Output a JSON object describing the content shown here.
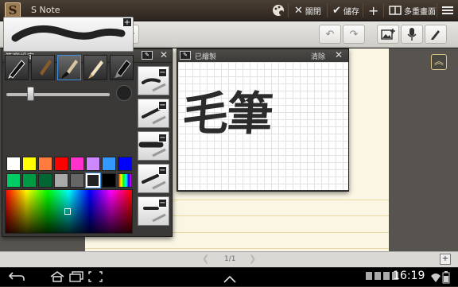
{
  "app": {
    "icon_letter": "S",
    "title": "S Note"
  },
  "actionbar": {
    "close_label": "關閉",
    "save_label": "儲存",
    "multiview_label": "多重畫面"
  },
  "pen_settings": {
    "title": "筆寫設定",
    "add_symbol": "+",
    "pen_types": [
      "fountain-pen",
      "brush",
      "calligraphy-brush",
      "pencil",
      "marker"
    ],
    "selected_pen_index": 2,
    "size_level": 0.2,
    "colors_row1": [
      "#ffffff",
      "#ffff00",
      "#ff7a3c",
      "#ff0000",
      "#ff33cc",
      "#cc88ff",
      "#3399ff",
      "#0000ff"
    ],
    "colors_row2": [
      "#00cc66",
      "#009944",
      "#006633",
      "#aaaaaa",
      "#666666",
      "#222222",
      "#000000",
      "rainbow"
    ],
    "selected_color_index": 13
  },
  "presets": {
    "count": 5,
    "remove_symbol": "−"
  },
  "recent_drawing": {
    "title": "已繪製",
    "clear_label": "清除",
    "drawn_text": "毛筆"
  },
  "page": {
    "indicator": "1/1"
  },
  "system": {
    "clock": "16:19"
  },
  "accent_color": "#7a5b3e"
}
